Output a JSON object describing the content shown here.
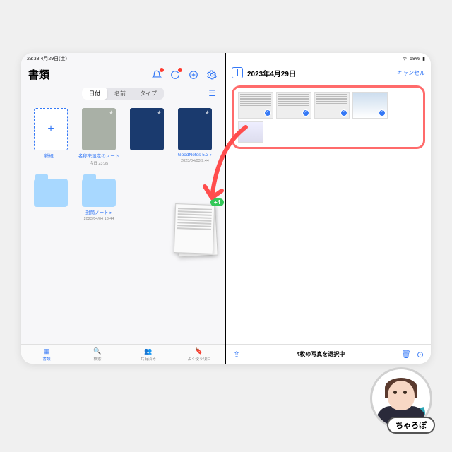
{
  "status": {
    "time": "23:38",
    "date": "4月29日(土)",
    "battery": "58%"
  },
  "left": {
    "title": "書類",
    "segments": {
      "s1": "日付",
      "s2": "名前",
      "s3": "タイプ"
    },
    "tiles": {
      "new": {
        "label": "新規..."
      },
      "t1": {
        "label": "名称未設定のノート",
        "sub": "今日 23:35"
      },
      "t2": {
        "label": "",
        "sub": ""
      },
      "t3": {
        "label": "GoodNotes 5.3 ▸",
        "sub": "2023/04/03 9:44"
      },
      "f1": {
        "label": "",
        "sub": ""
      },
      "f2": {
        "label": "封筒ノート ▸",
        "sub": "2023/04/04 13:44"
      }
    },
    "tabs": {
      "t1": "書類",
      "t2": "検索",
      "t3": "共有済み",
      "t4": "よく使う項目"
    }
  },
  "right": {
    "title": "2023年4月29日",
    "cancel": "キャンセル",
    "footer": "4枚の写真を選択中"
  },
  "drag": {
    "badge": "+4"
  },
  "author": "ちゃろぽ"
}
